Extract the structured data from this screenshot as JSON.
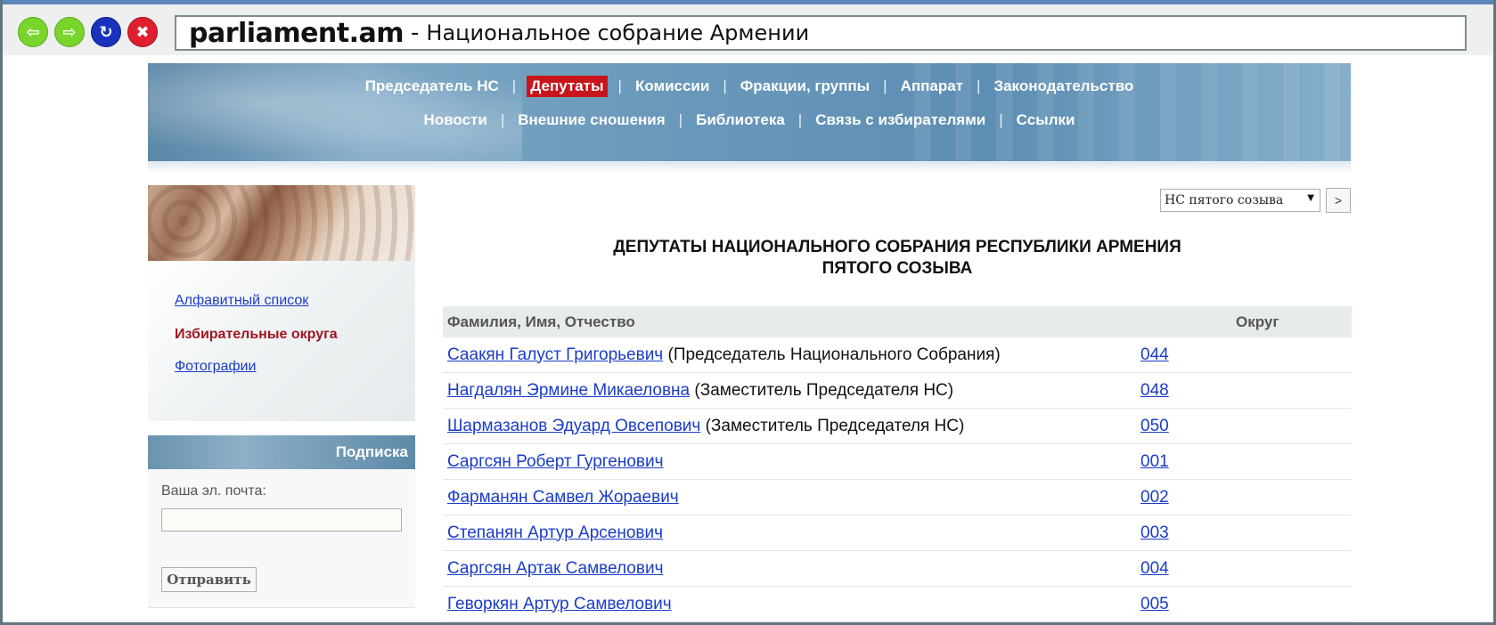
{
  "browser": {
    "url_domain": "parliament.am",
    "url_separator": "-",
    "page_title": "Национальное собрание Армении",
    "buttons": [
      {
        "icon": "back-arrow-icon",
        "glyph": "⇦"
      },
      {
        "icon": "forward-arrow-icon",
        "glyph": "⇨"
      },
      {
        "icon": "refresh-icon",
        "glyph": "↻"
      },
      {
        "icon": "close-icon",
        "glyph": "✖"
      }
    ]
  },
  "header": {
    "nav_row1": [
      "Председатель НС",
      "Депутаты",
      "Комиссии",
      "Фракции, группы",
      "Аппарат",
      "Законодательство"
    ],
    "nav_row2": [
      "Новости",
      "Внешние сношения",
      "Библиотека",
      "Связь с избирателями",
      "Ссылки"
    ],
    "active_item": "Депутаты",
    "separator": "|"
  },
  "sidebar": {
    "links": [
      {
        "label": "Алфавитный список",
        "current": false
      },
      {
        "label": "Избирательные округа",
        "current": true
      },
      {
        "label": "Фотографии",
        "current": false
      }
    ]
  },
  "subscription": {
    "title": "Подписка",
    "email_label": "Ваша эл. почта:",
    "email_value": "",
    "submit_label": "Отправить"
  },
  "convocation": {
    "selected": "НС пятого созыва",
    "go_label": ">"
  },
  "main": {
    "title_line1": "ДЕПУТАТЫ НАЦИОНАЛЬНОГО СОБРАНИЯ РЕСПУБЛИКИ АРМЕНИЯ",
    "title_line2": "ПЯТОГО СОЗЫВА",
    "columns": [
      "Фамилия, Имя, Отчество",
      "Округ"
    ],
    "rows": [
      {
        "name": "Саакян Галуст Григорьевич",
        "role": "(Председатель Национального Собрания)",
        "district": "044"
      },
      {
        "name": "Нагдалян Эрмине Микаеловна",
        "role": "(Заместитель Председателя НС)",
        "district": "048"
      },
      {
        "name": "Шармазанов Эдуард Овсепович",
        "role": "(Заместитель Председателя НС)",
        "district": "050"
      },
      {
        "name": "Саргсян Роберт Гургенович",
        "role": "",
        "district": "001"
      },
      {
        "name": "Фарманян Самвел Жораевич",
        "role": "",
        "district": "002"
      },
      {
        "name": "Степанян Артур Арсенович",
        "role": "",
        "district": "003"
      },
      {
        "name": "Саргсян Артак Самвелович",
        "role": "",
        "district": "004"
      },
      {
        "name": "Геворкян Артур Самвелович",
        "role": "",
        "district": "005"
      }
    ]
  },
  "colors": {
    "link": "#1a3cc9",
    "active_nav": "#c8151b",
    "current_sidebar": "#a01621",
    "chrome_accent": "#5b86b8"
  }
}
